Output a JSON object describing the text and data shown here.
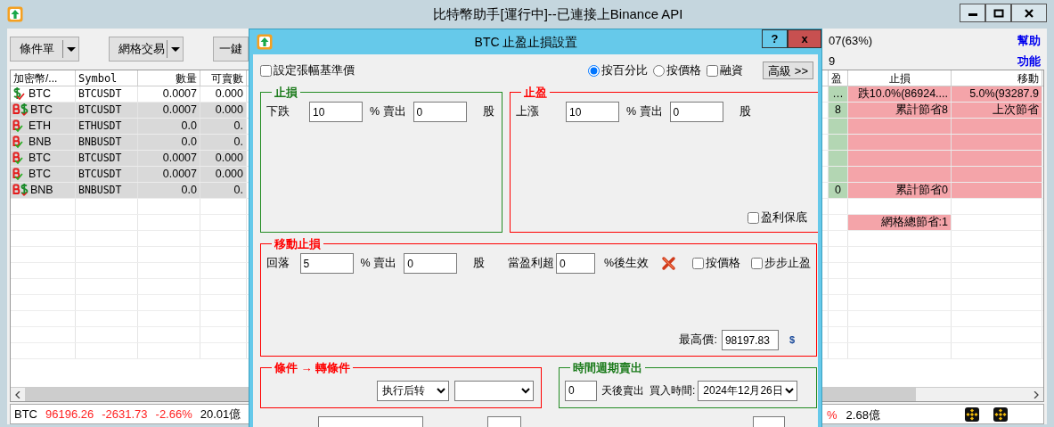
{
  "window": {
    "title": "比特幣助手[運行中]--已連接上Binance API"
  },
  "toolbar": {
    "buttons": [
      {
        "label": "條件單",
        "dropdown": true
      },
      {
        "label": "網格交易",
        "dropdown": true
      },
      {
        "label": "一鍵",
        "dropdown": false
      }
    ],
    "info_lines": [
      "07(63%)",
      "9"
    ],
    "links": [
      "幫助",
      "功能"
    ]
  },
  "table": {
    "columns": [
      "加密幣/...",
      "Symbol",
      "數量",
      "可賣數"
    ],
    "right_columns": [
      "盈",
      "止損",
      "移動"
    ],
    "rows": [
      {
        "kind": "dollar",
        "shaded": false,
        "cells": [
          "BTC",
          "BTCUSDT",
          "0.0007",
          "0.000"
        ],
        "right": [
          {
            "text": "…",
            "highlighted": true
          },
          {
            "text": "跌10.0%(86924....",
            "highlighted": true
          },
          {
            "text": "5.0%(93287.9",
            "highlighted": true
          }
        ]
      },
      {
        "kind": "b-dollar",
        "shaded": true,
        "cells": [
          "BTC",
          "BTCUSDT",
          "0.0007",
          "0.000"
        ],
        "right": [
          {
            "text": "8",
            "highlighted": true
          },
          {
            "text": "累計節省8",
            "highlighted": true
          },
          {
            "text": "上次節省",
            "highlighted": true
          }
        ]
      },
      {
        "kind": "b",
        "shaded": true,
        "cells": [
          "ETH",
          "ETHUSDT",
          "0.0",
          "0."
        ],
        "right": [
          {
            "highlighted": true
          },
          {
            "highlighted": true
          },
          {
            "highlighted": true
          }
        ]
      },
      {
        "kind": "b",
        "shaded": true,
        "cells": [
          "BNB",
          "BNBUSDT",
          "0.0",
          "0."
        ],
        "right": [
          {
            "highlighted": true
          },
          {
            "highlighted": true
          },
          {
            "highlighted": true
          }
        ]
      },
      {
        "kind": "b",
        "shaded": true,
        "cells": [
          "BTC",
          "BTCUSDT",
          "0.0007",
          "0.000"
        ],
        "right": [
          {
            "highlighted": true
          },
          {
            "highlighted": true
          },
          {
            "highlighted": true
          }
        ]
      },
      {
        "kind": "b",
        "shaded": true,
        "cells": [
          "BTC",
          "BTCUSDT",
          "0.0007",
          "0.000"
        ],
        "right": [
          {
            "highlighted": true
          },
          {
            "highlighted": true
          },
          {
            "highlighted": true
          }
        ]
      },
      {
        "kind": "b-dollar",
        "shaded": true,
        "cells": [
          "BNB",
          "BNBUSDT",
          "0.0",
          "0."
        ],
        "right": [
          {
            "text": "0",
            "highlighted": true
          },
          {
            "text": "累計節省0",
            "highlighted": true
          },
          {
            "highlighted": true
          }
        ]
      }
    ],
    "grid_total": "網格總節省:1"
  },
  "status_bar": {
    "symbol": "BTC",
    "price": "96196.26",
    "change": "-2631.73",
    "percent": "-2.66%",
    "volume": "20.01億",
    "right_percent": "%",
    "right_volume": "2.68億"
  },
  "dialog": {
    "title": "BTC 止盈止損設置",
    "help_button": "?",
    "close_button": "x",
    "base_price": {
      "label": "設定張幅基準價",
      "checked": false
    },
    "modes": [
      {
        "label": "按百分比",
        "selected": true
      },
      {
        "label": "按價格",
        "selected": false
      }
    ],
    "margin": {
      "label": "融資",
      "checked": false
    },
    "advanced_button": "高級 >>",
    "stop_loss": {
      "title": "止損",
      "prefix": "下跌",
      "percent": "10",
      "unit": "% 賣出",
      "shares": "0",
      "shares_unit": "股"
    },
    "take_profit": {
      "title": "止盈",
      "prefix": "上漲",
      "percent": "10",
      "unit": "% 賣出",
      "shares": "0",
      "shares_unit": "股",
      "guarantee": {
        "label": "盈利保底",
        "checked": false
      }
    },
    "trailing": {
      "title": "移動止損",
      "prefix": "回落",
      "percent": "5",
      "unit": "% 賣出",
      "shares": "0",
      "shares_unit": "股",
      "trigger_label": "當盈利超",
      "trigger": "0",
      "trigger_unit": "%後生效",
      "options": [
        {
          "label": "按價格",
          "checked": false
        },
        {
          "label": "步步止盈",
          "checked": false
        }
      ],
      "high_label": "最高價:",
      "high": "98197.83",
      "currency": "$"
    },
    "condition": {
      "title": "條件 → 轉條件",
      "action": "执行后转"
    },
    "time_sell": {
      "title": "時間週期賣出",
      "days": "0",
      "days_label": "天後賣出",
      "buy_label": "買入時間:",
      "buy_date": "2024年12月26日"
    }
  }
}
